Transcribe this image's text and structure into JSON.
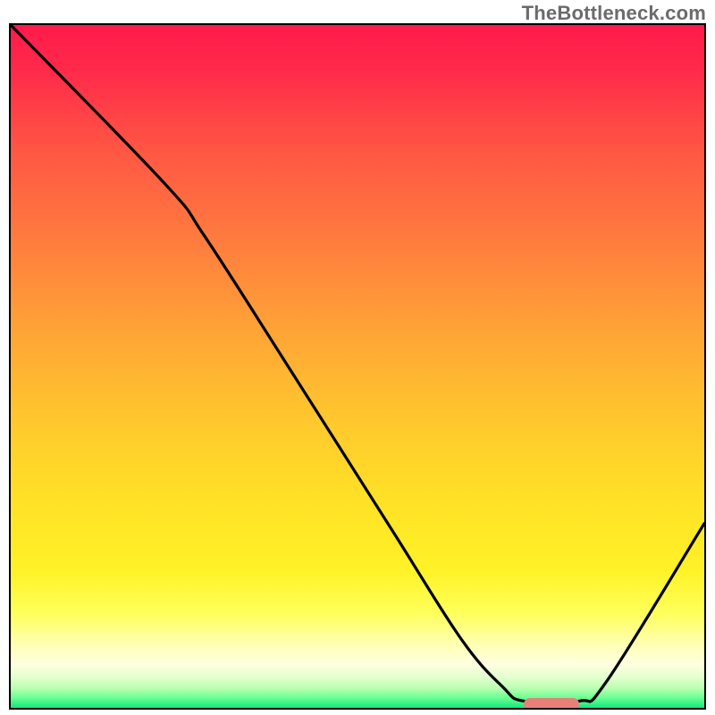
{
  "watermark_text": "TheBottleneck.com",
  "colors": {
    "curve": "#000000",
    "marker": "#e97f79",
    "border": "#000000"
  },
  "chart_data": {
    "type": "line",
    "title": "",
    "xlabel": "",
    "ylabel": "",
    "xlim": [
      0,
      100
    ],
    "ylim": [
      0,
      100
    ],
    "grid": false,
    "legend": null,
    "curve_points": [
      {
        "x": 0,
        "y": 100
      },
      {
        "x": 22,
        "y": 77
      },
      {
        "x": 28,
        "y": 69
      },
      {
        "x": 40,
        "y": 50
      },
      {
        "x": 55,
        "y": 26
      },
      {
        "x": 65,
        "y": 10
      },
      {
        "x": 71,
        "y": 3
      },
      {
        "x": 74,
        "y": 1
      },
      {
        "x": 82,
        "y": 1
      },
      {
        "x": 86,
        "y": 4
      },
      {
        "x": 100,
        "y": 27
      }
    ],
    "optimal_zone": {
      "x_start": 74,
      "x_end": 82,
      "y": 0.5
    },
    "annotations": []
  }
}
